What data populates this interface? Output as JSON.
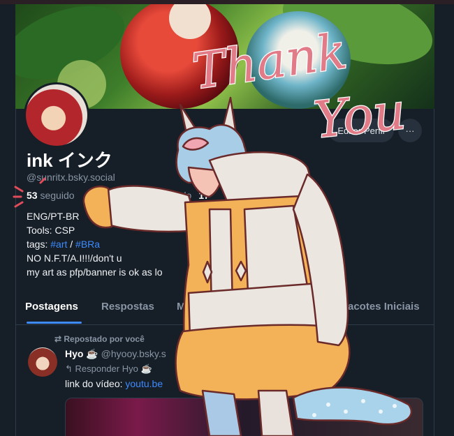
{
  "profile": {
    "name": "ink インク",
    "handle": "@sunritx.bsky.social",
    "followers_count": "53",
    "followers_label": "seguido",
    "following_label": "guindo",
    "posts_count": "17",
    "edit_button": "Editar Perfil",
    "more_button": "···",
    "bio_lines": [
      "ENG/PT-BR",
      "Tools: CSP",
      "tags: ",
      "NO N.F.T/A.I!!!/don't u",
      "my art as pfp/banner is ok as lo"
    ],
    "bio_tag_art": "#art",
    "bio_tag_sep": " / ",
    "bio_tag_br": "#BRa"
  },
  "tabs": [
    "Postagens",
    "Respostas",
    "M",
    "acotes Iniciais"
  ],
  "post": {
    "repost_label": "Repostado por você",
    "author_name": "Hyo",
    "author_emoji": "☕",
    "author_handle": "@hyooy.bsky.s",
    "reply_label": "Responder Hyo",
    "reply_emoji": "☕",
    "text": "link do vídeo: ",
    "link": "youtu.be"
  },
  "overlay": {
    "thank": "Thank",
    "you": "You"
  },
  "colors": {
    "background": "#161e27",
    "accent": "#3d8bfd",
    "muted": "#8895a5",
    "thank_you": "#e07b87"
  }
}
